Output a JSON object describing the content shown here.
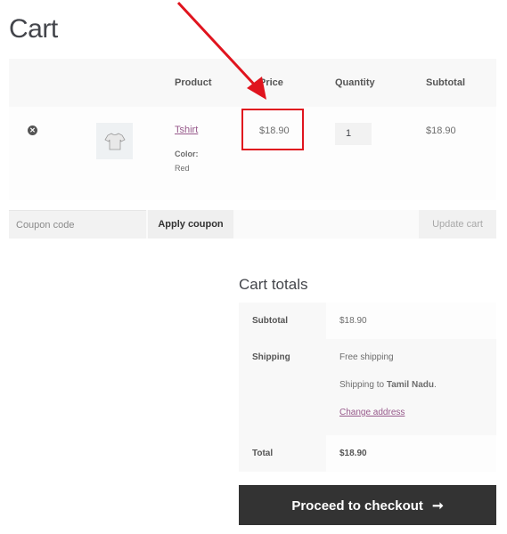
{
  "page": {
    "title": "Cart"
  },
  "cart_table": {
    "headers": [
      "",
      "",
      "Product",
      "Price",
      "Quantity",
      "Subtotal"
    ],
    "items": [
      {
        "remove_icon": "remove-circle-icon",
        "thumbnail": "tshirt-image",
        "product_name": "Tshirt",
        "attribute_label": "Color:",
        "attribute_value": "Red",
        "price": "$18.90",
        "quantity": "1",
        "subtotal": "$18.90"
      }
    ]
  },
  "actions": {
    "coupon_placeholder": "Coupon code",
    "apply_coupon_label": "Apply coupon",
    "update_cart_label": "Update cart"
  },
  "cart_totals": {
    "title": "Cart totals",
    "subtotal_label": "Subtotal",
    "subtotal_value": "$18.90",
    "shipping_label": "Shipping",
    "shipping_method": "Free shipping",
    "shipping_to_prefix": "Shipping to ",
    "shipping_destination": "Tamil Nadu",
    "shipping_to_suffix": ".",
    "change_address_label": "Change address",
    "total_label": "Total",
    "total_value": "$18.90"
  },
  "checkout": {
    "label": "Proceed to checkout",
    "icon": "arrow-right-icon",
    "glyph": "➞"
  },
  "annotation": {
    "color": "#e0141e",
    "target": "price"
  }
}
